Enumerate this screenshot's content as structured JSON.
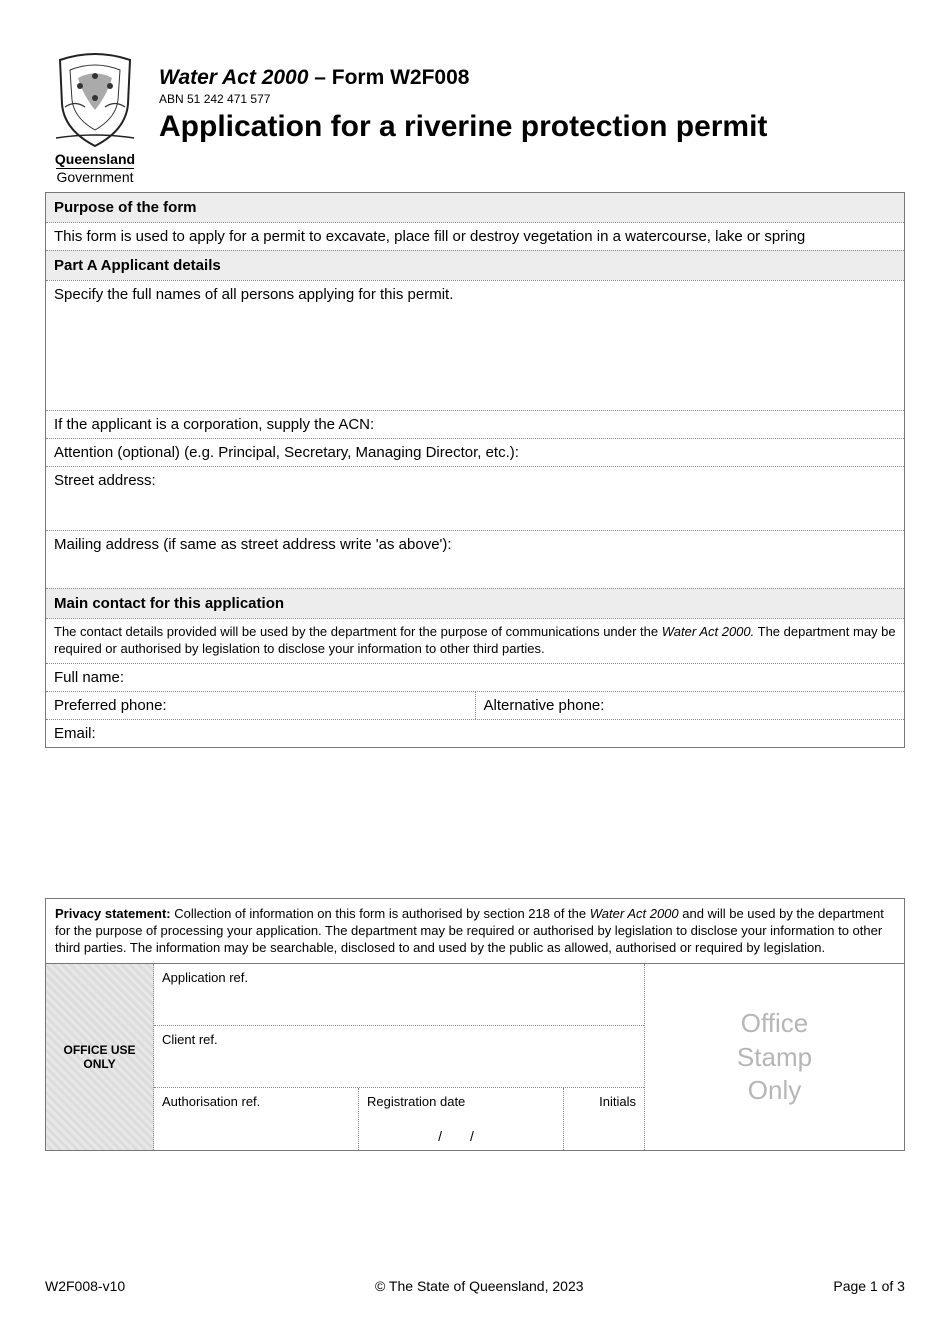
{
  "header": {
    "logo_line1": "Queensland",
    "logo_line2": "Government",
    "act_prefix": "Water Act 2000",
    "act_suffix": " – Form W2F008",
    "abn": "ABN 51 242 471 577",
    "title": "Application for a riverine protection permit"
  },
  "sections": {
    "purpose_heading": "Purpose of the form",
    "purpose_text": "This form is used to apply for a permit to excavate, place fill or destroy vegetation in a watercourse, lake or spring",
    "partA_heading": "Part A   Applicant details",
    "applicant_names_label": "Specify the full names of all persons applying for this permit.",
    "acn_label": "If the applicant is a corporation, supply the ACN:",
    "attention_label": "Attention (optional) (e.g. Principal, Secretary, Managing Director, etc.):",
    "street_label": "Street address:",
    "mailing_label": "Mailing address (if same as street address write 'as above'):",
    "main_contact_heading": "Main contact for this application",
    "main_contact_intro_pre": "The contact details provided will be used by the department for the purpose of communications under the ",
    "main_contact_intro_act": "Water Act 2000.",
    "main_contact_intro_post": " The department may be required or authorised by legislation to disclose your information to other third parties.",
    "fullname_label": "Full name:",
    "pref_phone_label": "Preferred phone:",
    "alt_phone_label": "Alternative phone:",
    "email_label": "Email:"
  },
  "privacy": {
    "label": "Privacy statement:",
    "text_pre": " Collection of information on this form is authorised by section 218 of the ",
    "act": "Water Act 2000",
    "text_post": " and will be used by the department for the purpose of processing your application. The department may be required or authorised by legislation to disclose your information to other third parties. The information may be searchable, disclosed to and used by the public as allowed, authorised or required by legislation."
  },
  "office": {
    "label_line1": "OFFICE USE",
    "label_line2": "ONLY",
    "app_ref": "Application ref.",
    "client_ref": "Client ref.",
    "auth_ref": "Authorisation ref.",
    "reg_date": "Registration date",
    "date_sep": "/",
    "initials": "Initials",
    "stamp_line1": "Office",
    "stamp_line2": "Stamp",
    "stamp_line3": "Only"
  },
  "footer": {
    "left": "W2F008-v10",
    "center": "© The State of Queensland, 2023",
    "right": "Page 1 of 3"
  }
}
